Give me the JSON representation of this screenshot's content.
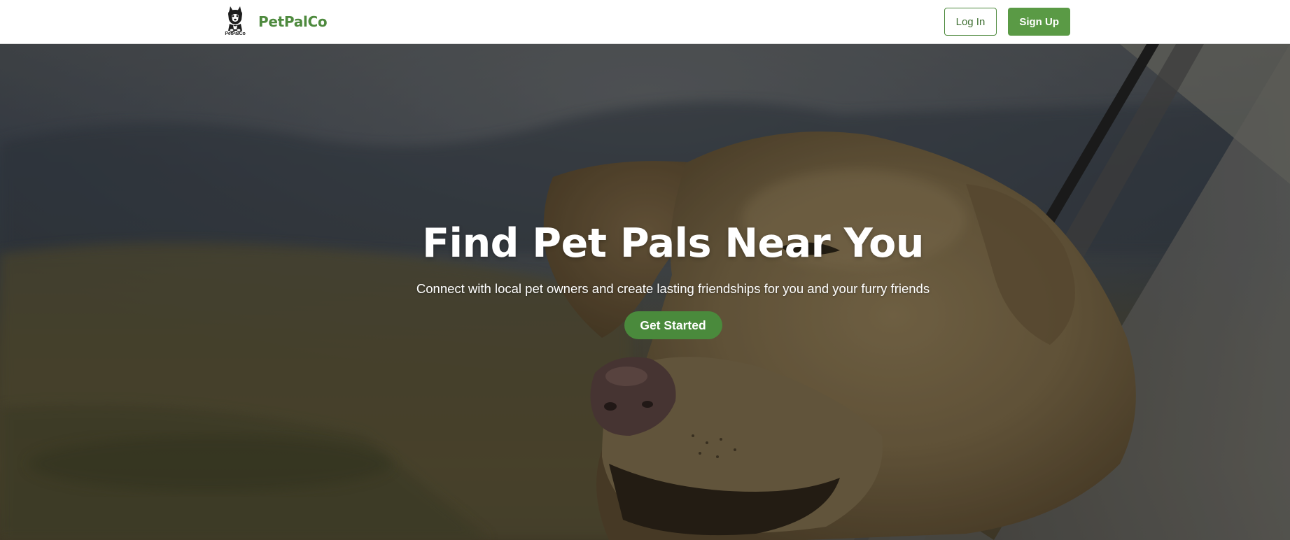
{
  "header": {
    "logo_icon": "husky-dog-logo-icon",
    "logo_caption": "PetPalCo",
    "brand_name": "PetPalCo",
    "login_label": "Log In",
    "signup_label": "Sign Up"
  },
  "hero": {
    "background_image": "golden-labrador-leaning-out-car-window-photo",
    "title": "Find Pet Pals Near You",
    "subtitle": "Connect with local pet owners and create lasting friendships for you and your furry friends",
    "cta_label": "Get Started"
  },
  "colors": {
    "brand_green": "#4e8a3e",
    "button_green": "#5a9a45",
    "cta_green": "#4a8a3c",
    "header_bg": "#ffffff",
    "hero_text": "#ffffff"
  }
}
